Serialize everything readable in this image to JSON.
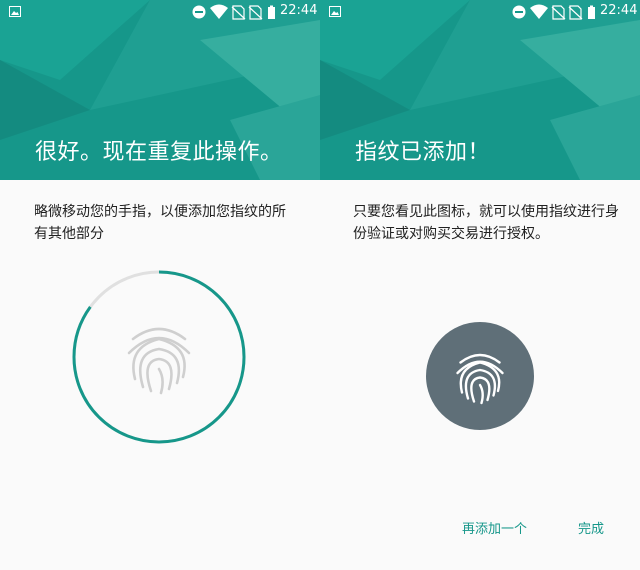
{
  "status_bar": {
    "time": "22:44",
    "icons": [
      "gallery-icon",
      "do-not-disturb-icon",
      "wifi-icon",
      "no-sim-icon",
      "no-sim-icon",
      "battery-icon"
    ]
  },
  "screen_left": {
    "title": "很好。现在重复此操作。",
    "instruction": "略微移动您的手指，以便添加您指纹的所有其他部分",
    "progress_fraction": 0.85,
    "icon": "fingerprint-icon"
  },
  "screen_right": {
    "title": "指纹已添加！",
    "description": "只要您看见此图标，就可以使用指纹进行身份验证或对购买交易进行授权。",
    "icon": "fingerprint-icon",
    "buttons": {
      "add_another": "再添加一个",
      "done": "完成"
    }
  },
  "colors": {
    "accent": "#16978a",
    "header_bg": "#16978a",
    "fingerprint_circle": "#5f6f78",
    "progress_track": "#e0e0e0"
  }
}
